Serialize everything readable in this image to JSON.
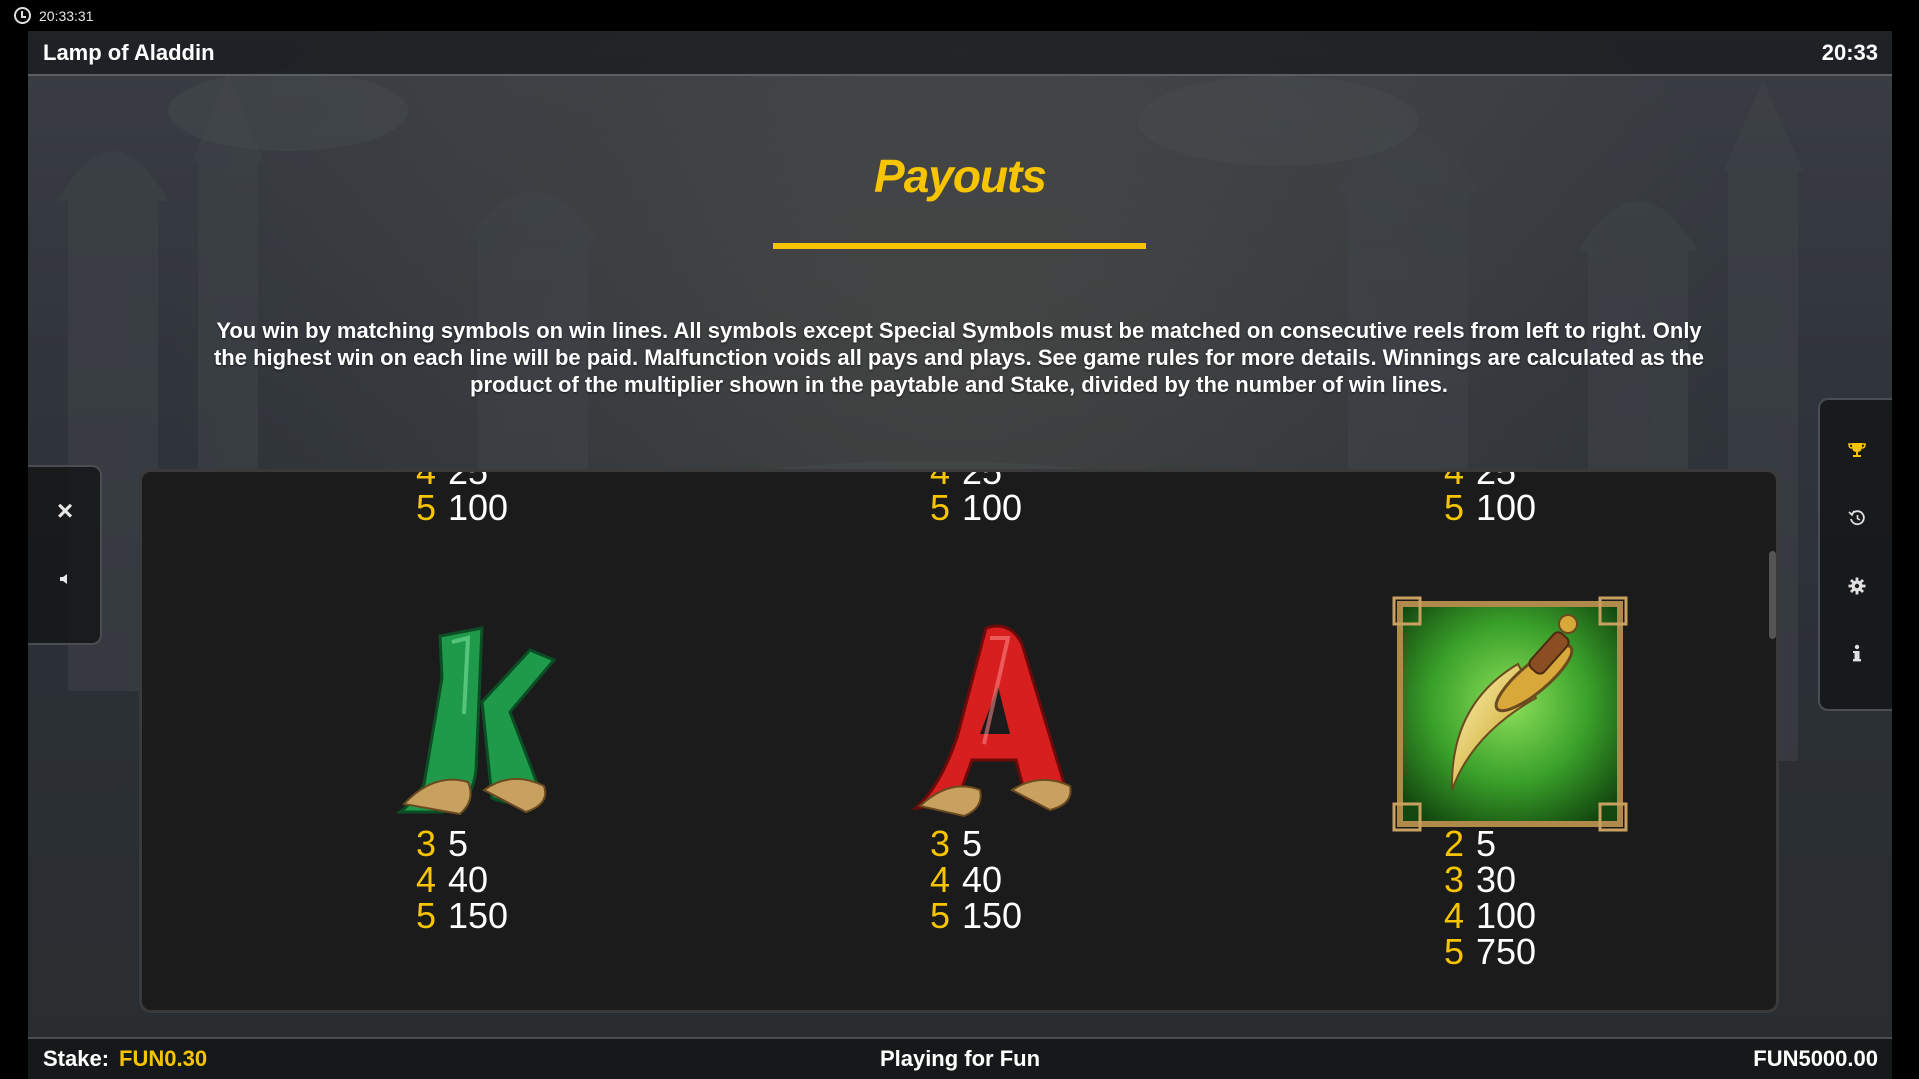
{
  "system": {
    "time": "20:33:31",
    "icon": "clock-icon"
  },
  "header": {
    "title": "Lamp of Aladdin",
    "clock": "20:33"
  },
  "page": {
    "heading": "Payouts",
    "intro": "You win by matching symbols on win lines. All symbols except Special Symbols must be matched on consecutive reels from left to right. Only the highest win on each line will be paid. Malfunction voids all pays and plays. See game rules for more details. Winnings are calculated as the product of the multiplier shown in the paytable and Stake, divided by the number of win lines."
  },
  "left_controls": {
    "close": "close-icon",
    "sound": "speaker-icon"
  },
  "right_menu": [
    "trophy-icon",
    "history-icon",
    "gear-icon",
    "info-icon"
  ],
  "paytable": {
    "top_partial": [
      {
        "rows": [
          {
            "count": "4",
            "amount": "25"
          },
          {
            "count": "5",
            "amount": "100"
          }
        ]
      },
      {
        "rows": [
          {
            "count": "4",
            "amount": "25"
          },
          {
            "count": "5",
            "amount": "100"
          }
        ]
      },
      {
        "rows": [
          {
            "count": "4",
            "amount": "25"
          },
          {
            "count": "5",
            "amount": "100"
          }
        ]
      }
    ],
    "symbols": [
      {
        "icon": "letter-k-symbol",
        "color": "#1f9a4a",
        "rows": [
          {
            "count": "3",
            "amount": "5"
          },
          {
            "count": "4",
            "amount": "40"
          },
          {
            "count": "5",
            "amount": "150"
          }
        ]
      },
      {
        "icon": "letter-a-symbol",
        "color": "#d81f1f",
        "rows": [
          {
            "count": "3",
            "amount": "5"
          },
          {
            "count": "4",
            "amount": "40"
          },
          {
            "count": "5",
            "amount": "150"
          }
        ]
      },
      {
        "icon": "dagger-symbol",
        "color": "#3aa12a",
        "rows": [
          {
            "count": "2",
            "amount": "5"
          },
          {
            "count": "3",
            "amount": "30"
          },
          {
            "count": "4",
            "amount": "100"
          },
          {
            "count": "5",
            "amount": "750"
          }
        ]
      }
    ]
  },
  "footer": {
    "stake_label": "Stake:",
    "stake_value": "FUN0.30",
    "mode": "Playing for Fun",
    "balance": "FUN5000.00"
  },
  "colors": {
    "accent": "#f7c400",
    "panel": "#1b1b1b"
  }
}
